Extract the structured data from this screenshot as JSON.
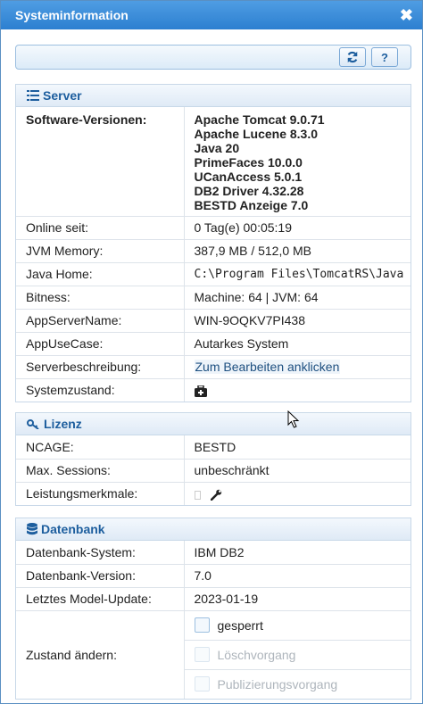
{
  "dialog": {
    "title": "Systeminformation",
    "close_glyph": "✖"
  },
  "toolbar": {
    "refresh_icon": "refresh-icon",
    "help_label": "?"
  },
  "server": {
    "title": "Server",
    "software_label": "Software-Versionen:",
    "software_versions": [
      "Apache Tomcat 9.0.71",
      "Apache Lucene 8.3.0",
      "Java 20",
      "PrimeFaces 10.0.0",
      "UCanAccess 5.0.1",
      "DB2 Driver 4.32.28",
      "BESTD Anzeige 7.0"
    ],
    "rows": [
      {
        "label": "Online seit:",
        "value": "0 Tag(e) 00:05:19"
      },
      {
        "label": "JVM Memory:",
        "value": "387,9 MB / 512,0 MB"
      },
      {
        "label": "Java Home:",
        "value": "C:\\Program Files\\TomcatRS\\Java"
      },
      {
        "label": "Bitness:",
        "value": "Machine: 64 | JVM: 64"
      },
      {
        "label": "AppServerName:",
        "value": "WIN-9OQKV7PI438"
      },
      {
        "label": "AppUseCase:",
        "value": "Autarkes System"
      },
      {
        "label": "Serverbeschreibung:",
        "value": "Zum Bearbeiten anklicken"
      },
      {
        "label": "Systemzustand:",
        "value": ""
      }
    ]
  },
  "lizenz": {
    "title": "Lizenz",
    "rows": [
      {
        "label": "NCAGE:",
        "value": "BESTD"
      },
      {
        "label": "Max. Sessions:",
        "value": "unbeschränkt"
      },
      {
        "label": "Leistungsmerkmale:",
        "value": ""
      }
    ]
  },
  "datenbank": {
    "title": "Datenbank",
    "rows": [
      {
        "label": "Datenbank-System:",
        "value": "IBM DB2"
      },
      {
        "label": "Datenbank-Version:",
        "value": "7.0"
      },
      {
        "label": "Letztes Model-Update:",
        "value": "2023-01-19"
      }
    ],
    "state_label": "Zustand ändern:",
    "checkboxes": [
      {
        "label": "gesperrt",
        "checked": false,
        "disabled": false
      },
      {
        "label": "Löschvorgang",
        "checked": false,
        "disabled": true
      },
      {
        "label": "Publizierungsvorgang",
        "checked": false,
        "disabled": true
      }
    ]
  }
}
